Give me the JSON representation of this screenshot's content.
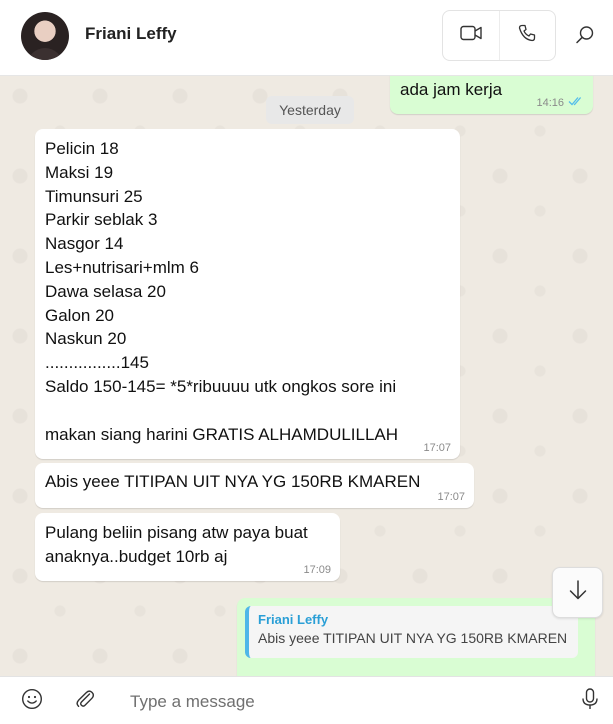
{
  "header": {
    "contact_name": "Friani Leffy",
    "icons": [
      "video-call-icon",
      "voice-call-icon",
      "search-icon"
    ]
  },
  "chat": {
    "date_separator": "Yesterday",
    "messages": [
      {
        "direction": "outgoing",
        "lines": [
          "ada jam kerja"
        ],
        "time": "14:16",
        "status": "read"
      },
      {
        "direction": "incoming",
        "lines": [
          "Pelicin 18",
          "Maksi 19",
          "Timunsuri 25",
          "Parkir seblak 3",
          "Nasgor 14",
          "Les+nutrisari+mlm 6",
          "Dawa selasa 20",
          "Galon 20",
          "Naskun 20",
          "................145",
          "Saldo 150-145= *5*ribuuuu utk ongkos sore ini",
          "",
          "makan siang harini GRATIS ALHAMDULILLAH"
        ],
        "time": "17:07"
      },
      {
        "direction": "incoming",
        "lines": [
          "Abis yeee TITIPAN UIT NYA YG 150RB KMAREN"
        ],
        "time": "17:07"
      },
      {
        "direction": "incoming",
        "lines": [
          "Pulang beliin pisang atw paya buat",
          "anaknya..budget 10rb aj"
        ],
        "time": "17:09"
      },
      {
        "direction": "outgoing",
        "quote": {
          "author": "Friani Leffy",
          "text": "Abis yeee TITIPAN UIT NYA YG 150RB KMAREN"
        }
      }
    ]
  },
  "composer": {
    "placeholder": "Type a message",
    "value": ""
  },
  "colors": {
    "outgoing_bubble": "#d9fdd3",
    "incoming_bubble": "#ffffff",
    "chat_background": "#efeae2",
    "read_ticks": "#53bdeb",
    "quote_accent": "#4fb7e8"
  }
}
